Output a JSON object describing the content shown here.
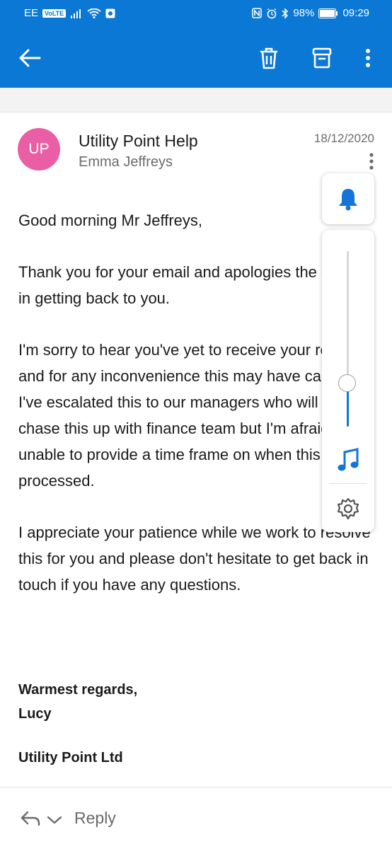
{
  "status_bar": {
    "carrier": "EE",
    "volte": "VoLTE",
    "battery": "98%",
    "time": "09:29"
  },
  "toolbar": {
    "back_icon": "arrow-left-icon",
    "delete_icon": "trash-icon",
    "archive_icon": "archive-icon",
    "more_icon": "more-vertical-icon"
  },
  "email": {
    "avatar_initials": "UP",
    "avatar_color": "#e95ea4",
    "sender": "Utility Point Help",
    "recipient": "Emma Jeffreys",
    "date": "18/12/2020",
    "body": [
      "Good morning Mr Jeffreys,",
      "Thank you for your email and apologies the delay in getting back to you.",
      "I'm sorry to hear you've yet to receive your refund and for any inconvenience this may have caused. I've escalated this to our managers who will now chase this up with finance team but I'm afraid I'm unable to provide a time frame on when this will be processed.",
      "I appreciate your patience while we work to resolve this for you and please don't hesitate to get back in touch if you have any questions."
    ],
    "sign_off": "Warmest regards,",
    "signature_name": "Lucy",
    "company": "Utility Point Ltd"
  },
  "reply": {
    "label": "Reply"
  },
  "volume_overlay": {
    "level": 0.25,
    "icons": [
      "bell-icon",
      "music-note-icon",
      "settings-gear-icon"
    ]
  },
  "colors": {
    "accent": "#0a78d4",
    "slider": "#1474d8"
  }
}
